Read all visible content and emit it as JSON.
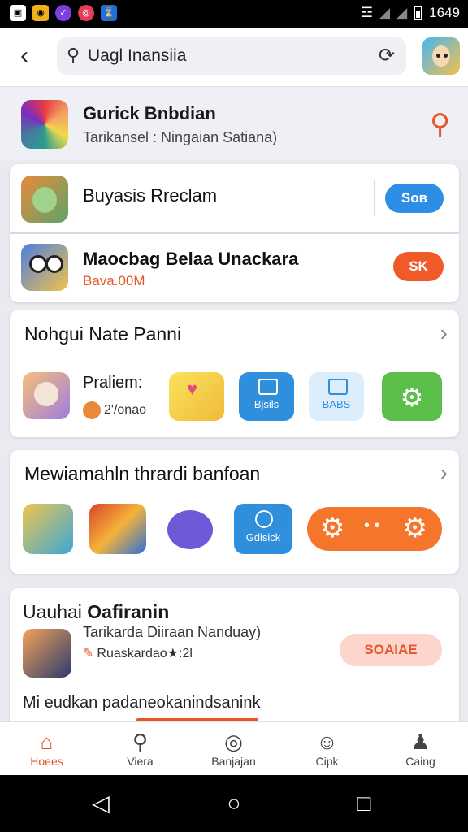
{
  "status_bar": {
    "time": "1649"
  },
  "search": {
    "query": "Uagl Inansiia"
  },
  "hero": {
    "title": "Gurick Bnbdian",
    "subtitle": "Tarikansel : Ningaian Satiana)"
  },
  "list": [
    {
      "title": "Buyasis Rreclam",
      "button": "Sов",
      "button_color": "#2d8ee6"
    },
    {
      "title": "Maocbag Belaa Unackara",
      "subtitle": "Bava.00M",
      "button": "SK",
      "button_color": "#f05a28"
    }
  ],
  "section1": {
    "title": "Nohgui Nate Panni",
    "featured": {
      "name": "Praliem:",
      "rating": "2'/onao"
    },
    "tiles": [
      "Bjsils",
      "BABS"
    ]
  },
  "section2": {
    "title": "Mewiamahln thrardi banfoan",
    "tiles": [
      "Gdisick"
    ]
  },
  "section3": {
    "title_part1": "Uauhai",
    "title_part2": "Oafiranin",
    "subtitle": "Tarikarda Diiraan Nanduay)",
    "meta": "Ruaskardao★:2l",
    "button": "SOAIAE",
    "footer_text": "Mi eudkan padaneokanindsanink"
  },
  "bottom_nav": [
    {
      "label": "Hoees",
      "icon": "home-icon",
      "active": true
    },
    {
      "label": "Viera",
      "icon": "chat-icon",
      "active": false
    },
    {
      "label": "Banjajan",
      "icon": "target-icon",
      "active": false
    },
    {
      "label": "Cipk",
      "icon": "gamepad-icon",
      "active": false
    },
    {
      "label": "Caing",
      "icon": "user-icon",
      "active": false
    }
  ]
}
